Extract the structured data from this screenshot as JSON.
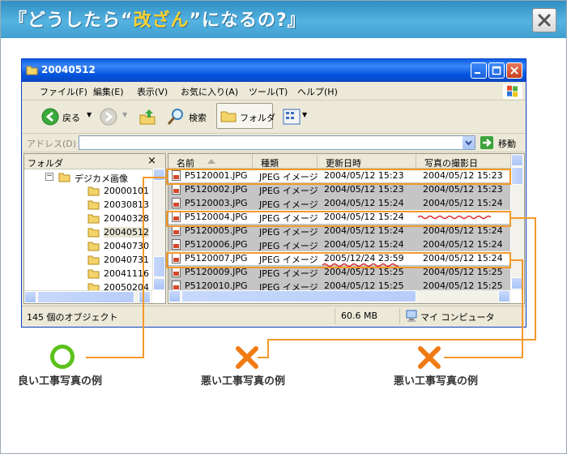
{
  "banner": {
    "title_pre": "『どうしたら“",
    "title_hl": "改ざん",
    "title_post": "”になるの?』"
  },
  "window": {
    "title": "20040512",
    "menu": [
      "ファイル(F)",
      "編集(E)",
      "表示(V)",
      "お気に入り(A)",
      "ツール(T)",
      "ヘルプ(H)"
    ],
    "toolbar": {
      "back": "戻る",
      "search": "検索",
      "folders": "フォルダ"
    },
    "address": {
      "label": "アドレス(D)",
      "value": "",
      "go": "移動"
    },
    "folder_pane": {
      "header": "フォルダ",
      "close": "×",
      "parent": "デジカメ画像",
      "items": [
        "20000101",
        "20030813",
        "20040328",
        "20040512",
        "20040730",
        "20040731",
        "20041116",
        "20050204"
      ],
      "selected": "20040512"
    },
    "file_pane": {
      "columns": [
        "名前",
        "種類",
        "更新日時",
        "写真の撮影日"
      ],
      "rows": [
        {
          "name": "P5120001.JPG",
          "type": "JPEG イメージ",
          "modified": "2004/05/12 15:23",
          "taken": "2004/05/12 15:23"
        },
        {
          "name": "P5120002.JPG",
          "type": "JPEG イメージ",
          "modified": "2004/05/12 15:23",
          "taken": "2004/05/12 15:23"
        },
        {
          "name": "P5120003.JPG",
          "type": "JPEG イメージ",
          "modified": "2004/05/12 15:24",
          "taken": "2004/05/12 15:24"
        },
        {
          "name": "P5120004.JPG",
          "type": "JPEG イメージ",
          "modified": "2004/05/12 15:24",
          "taken": ""
        },
        {
          "name": "P5120005.JPG",
          "type": "JPEG イメージ",
          "modified": "2004/05/12 15:24",
          "taken": "2004/05/12 15:24"
        },
        {
          "name": "P5120006.JPG",
          "type": "JPEG イメージ",
          "modified": "2004/05/12 15:24",
          "taken": "2004/05/12 15:24"
        },
        {
          "name": "P5120007.JPG",
          "type": "JPEG イメージ",
          "modified": "2005/12/24 23:59",
          "taken": "2004/05/12 15:24"
        },
        {
          "name": "P5120009.JPG",
          "type": "JPEG イメージ",
          "modified": "2004/05/12 15:25",
          "taken": "2004/05/12 15:25"
        },
        {
          "name": "P5120010.JPG",
          "type": "JPEG イメージ",
          "modified": "2004/05/12 15:25",
          "taken": "2004/05/12 15:25"
        }
      ]
    },
    "status": {
      "count": "145 個のオブジェクト",
      "size": "60.6 MB",
      "location": "マイ コンピュータ"
    }
  },
  "annotations": {
    "good": "良い工事写真の例",
    "bad1": "悪い工事写真の例",
    "bad2": "悪い工事写真の例"
  },
  "colors": {
    "accent": "#f39a2b",
    "good_mark": "#5cc11c",
    "bad_mark": "#f07a14",
    "banner": "#3f9fd0",
    "highlight": "#ffd22e"
  }
}
